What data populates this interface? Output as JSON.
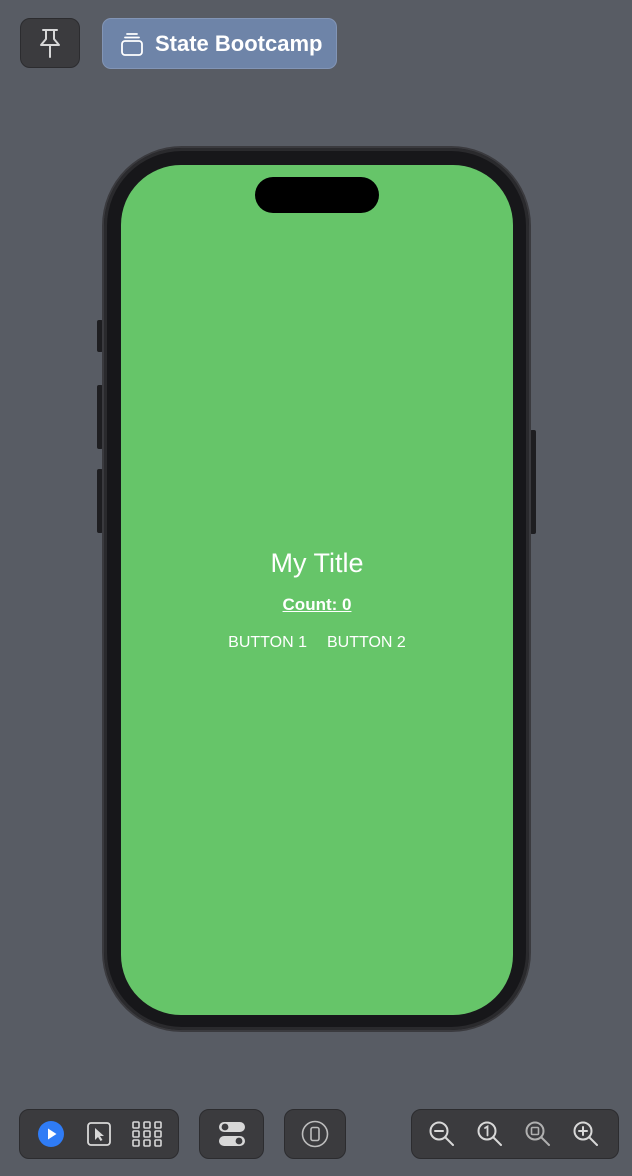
{
  "toolbar": {
    "pin_icon": "pin-icon",
    "preview_tab": {
      "icon": "stack-icon",
      "label": "State Bootcamp"
    }
  },
  "preview": {
    "background_color": "#66c569",
    "title": "My Title",
    "count_label": "Count: 0",
    "buttons": [
      "BUTTON 1",
      "BUTTON 2"
    ]
  },
  "bottom_toolbar": {
    "mode_group": [
      "play-icon",
      "select-icon",
      "grid-icon"
    ],
    "variants_icon": "toggles-icon",
    "device_settings_icon": "device-icon",
    "zoom_group": [
      "zoom-out-icon",
      "zoom-actual-icon",
      "zoom-fit-icon",
      "zoom-in-icon"
    ],
    "accent_color": "#2f7cf6"
  }
}
